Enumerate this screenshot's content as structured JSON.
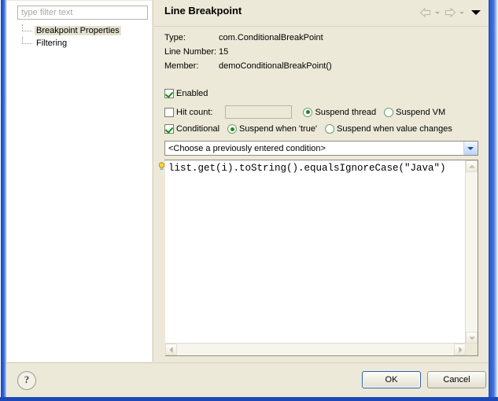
{
  "window": {
    "title": "Line Breakpoint"
  },
  "sidebar": {
    "filter": {
      "value": "",
      "placeholder": "type filter text"
    },
    "items": [
      {
        "label": "Breakpoint Properties",
        "selected": true
      },
      {
        "label": "Filtering",
        "selected": false
      }
    ]
  },
  "titlebar": {
    "back_icon": "back-arrow-icon",
    "forward_icon": "forward-arrow-icon",
    "menu_icon": "chevron-down-icon"
  },
  "info": {
    "type_label": "Type:",
    "type_value": "com.ConditionalBreakPoint",
    "line_label": "Line Number:",
    "line_value": "15",
    "member_label": "Member:",
    "member_value": "demoConditionalBreakPoint()"
  },
  "options": {
    "enabled": {
      "label": "Enabled",
      "checked": true
    },
    "hit_count": {
      "label": "Hit count:",
      "checked": false,
      "value": ""
    },
    "suspend_thread": {
      "label": "Suspend thread",
      "selected": true
    },
    "suspend_vm": {
      "label": "Suspend VM",
      "selected": false
    },
    "conditional": {
      "label": "Conditional",
      "checked": true
    },
    "suspend_true": {
      "label": "Suspend when 'true'",
      "selected": true
    },
    "suspend_change": {
      "label": "Suspend when value changes",
      "selected": false
    }
  },
  "condition_combo": {
    "value": "<Choose a previously entered condition>"
  },
  "editor": {
    "code": "list.get(i).toString().equalsIgnoreCase(\"Java\")",
    "gutter_icon": "lightbulb-icon"
  },
  "footer": {
    "help_label": "?",
    "ok_label": "OK",
    "cancel_label": "Cancel"
  },
  "colors": {
    "dialog_bg": "#ece9d8",
    "accent_blue": "#1b49b8",
    "check_green": "#1a8a1a"
  }
}
